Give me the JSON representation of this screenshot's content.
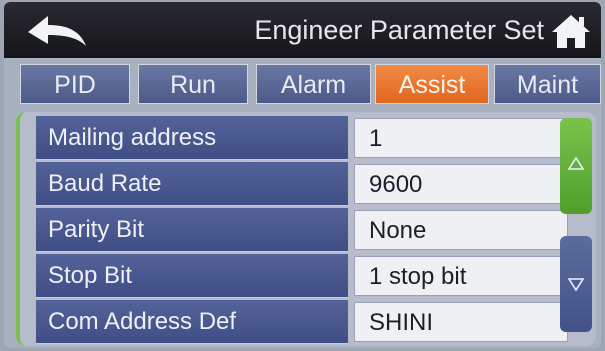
{
  "header": {
    "title": "Engineer Parameter Set",
    "back_icon": "back-arrow-icon",
    "home_icon": "home-icon"
  },
  "tabs": [
    {
      "label": "PID",
      "active": false
    },
    {
      "label": "Run",
      "active": false
    },
    {
      "label": "Alarm",
      "active": false
    },
    {
      "label": "Assist",
      "active": true
    },
    {
      "label": "Maint",
      "active": false
    }
  ],
  "parameters": [
    {
      "label": "Mailing address",
      "value": "1"
    },
    {
      "label": "Baud Rate",
      "value": "9600"
    },
    {
      "label": "Parity Bit",
      "value": "None"
    },
    {
      "label": "Stop Bit",
      "value": "1 stop bit"
    },
    {
      "label": "Com Address Def",
      "value": "SHINI"
    }
  ],
  "scroll": {
    "up_icon": "triangle-up-icon",
    "down_icon": "triangle-down-icon"
  },
  "colors": {
    "header_bg": "#1c1d22",
    "tab_bg": "#56649a",
    "tab_active": "#e8742e",
    "label_bg": "#4a5a90",
    "value_bg": "#eff0f4",
    "scroll_up": "#6bb83f",
    "scroll_down": "#4e5e94"
  }
}
